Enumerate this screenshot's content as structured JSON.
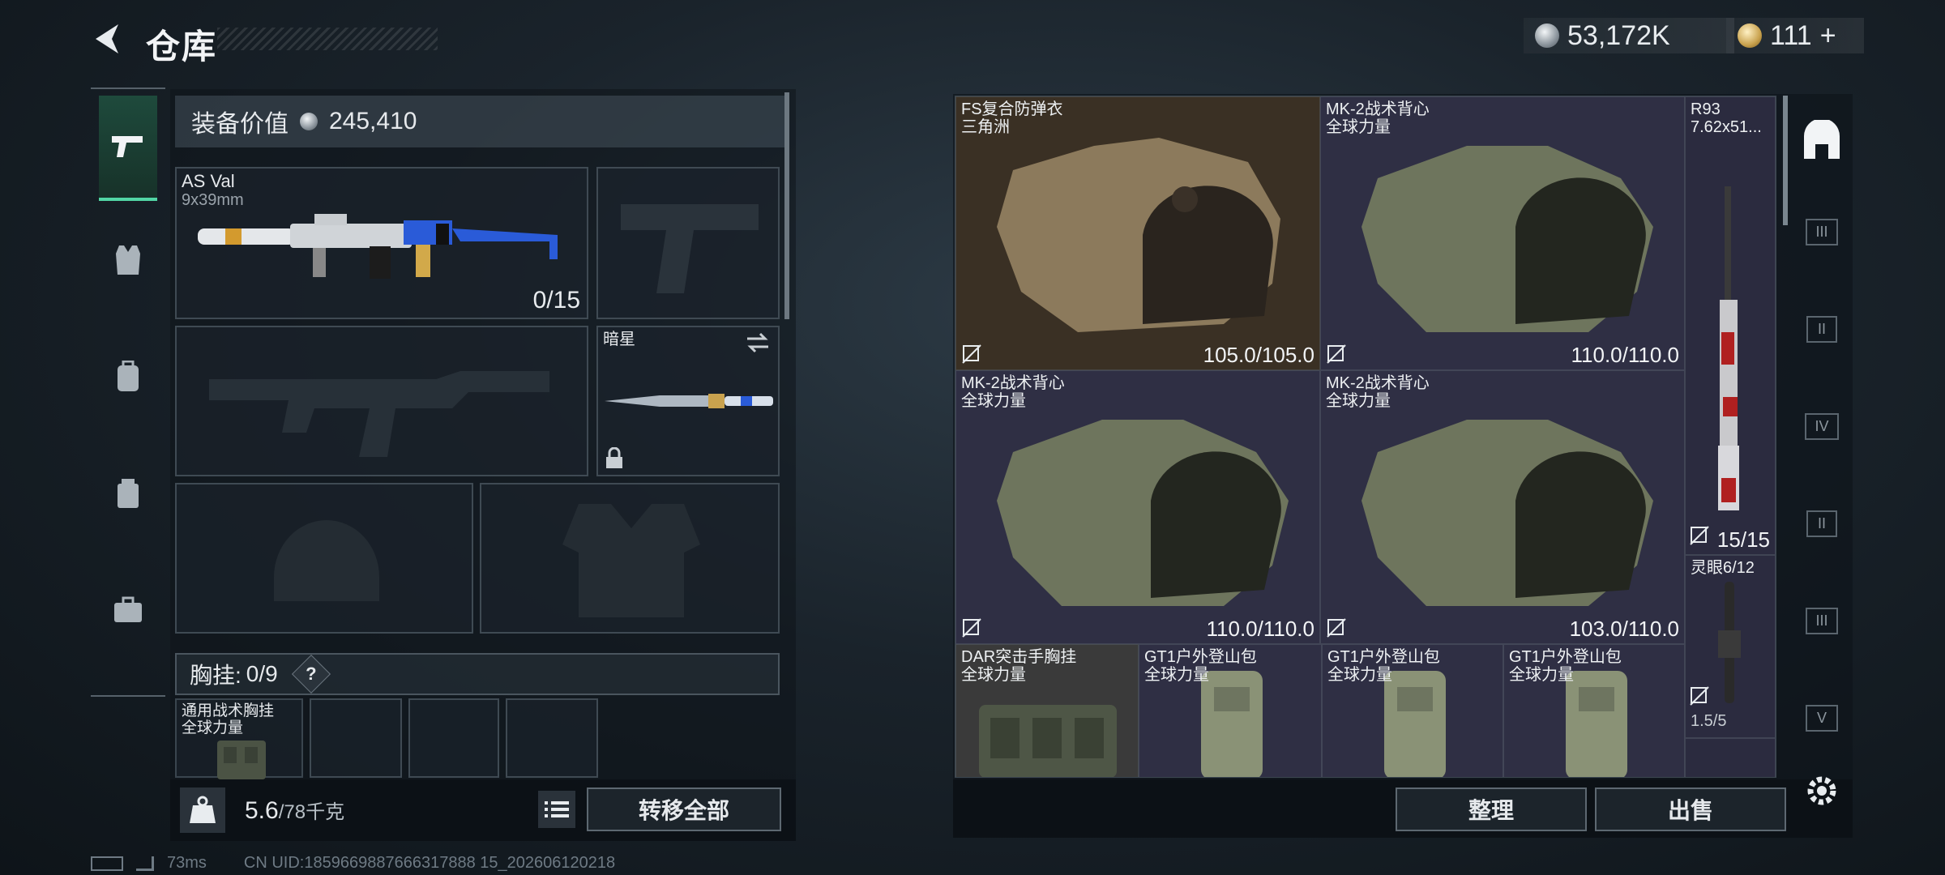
{
  "header": {
    "title": "仓库",
    "silver": "53,172K",
    "gold": "111",
    "gold_plus": "+"
  },
  "equip": {
    "value_label": "装备价值",
    "value": "245,410",
    "primary": {
      "name": "AS Val",
      "caliber": "9x39mm",
      "ammo": "0/15"
    },
    "melee": {
      "name": "暗星"
    },
    "chest": {
      "label": "胸挂:",
      "count": "0/9",
      "help": "?"
    },
    "chest_item": {
      "name": "通用战术胸挂",
      "faction": "全球力量"
    }
  },
  "weight": {
    "current": "5.6",
    "max": "/78千克",
    "kg_label": "KG"
  },
  "buttons": {
    "transfer_all": "转移全部",
    "sort": "整理",
    "sell": "出售"
  },
  "status": {
    "ping": "73ms",
    "uid": "CN UID:1859669887666317888 15_202606120218"
  },
  "inventory": [
    {
      "name": "FS复合防弹衣",
      "sub": "三角洲",
      "dur": "105.0/105.0"
    },
    {
      "name": "MK-2战术背心",
      "sub": "全球力量",
      "dur": "110.0/110.0"
    },
    {
      "name": "R93",
      "sub": "7.62x51...",
      "dur": "15/15"
    },
    {
      "name": "MK-2战术背心",
      "sub": "全球力量",
      "dur": "110.0/110.0"
    },
    {
      "name": "MK-2战术背心",
      "sub": "全球力量",
      "dur": "103.0/110.0"
    },
    {
      "name": "灵眼6/12",
      "sub": "",
      "dur": "1.5/5"
    },
    {
      "name": "DAR突击手胸挂",
      "sub": "全球力量",
      "dur": ""
    },
    {
      "name": "GT1户外登山包",
      "sub": "全球力量",
      "dur": ""
    },
    {
      "name": "GT1户外登山包",
      "sub": "全球力量",
      "dur": ""
    },
    {
      "name": "GT1户外登山包",
      "sub": "全球力量",
      "dur": ""
    }
  ],
  "right_rail": [
    "III",
    "II",
    "IV",
    "II",
    "III",
    "V"
  ],
  "colors": {
    "accent": "#52d6a5",
    "panel": "#1c242b",
    "tan_vest": "#6e5a44",
    "green_vest": "#3c4238"
  }
}
